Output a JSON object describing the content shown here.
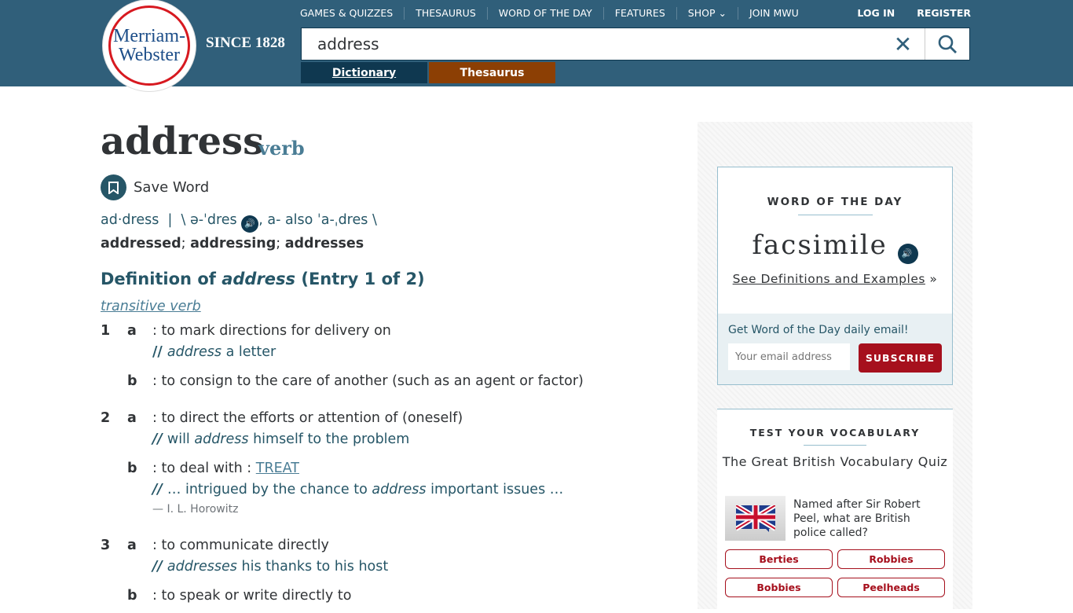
{
  "header": {
    "logo_text": "Merriam-Webster",
    "since": "SINCE 1828",
    "nav": [
      "GAMES & QUIZZES",
      "THESAURUS",
      "WORD OF THE DAY",
      "FEATURES",
      "SHOP",
      "JOIN MWU"
    ],
    "login": "LOG IN",
    "register": "REGISTER",
    "search_value": "address",
    "tabs": {
      "dictionary": "Dictionary",
      "thesaurus": "Thesaurus"
    },
    "colors": {
      "bar": "#305f7a",
      "dictionary_tab": "#0f3850",
      "thesaurus_tab": "#8c3f04"
    }
  },
  "entry": {
    "headword": "address",
    "pos": "verb",
    "save": "Save Word",
    "syllables": "ad·dress",
    "pron1": "\\ ə-ˈdres",
    "pron_also": ", a- also ˈa-ˌdres \\",
    "inflections": [
      "addressed",
      "addressing",
      "addresses"
    ],
    "def_heading_pre": "Definition of ",
    "def_heading_word": "address",
    "def_heading_post": " (Entry 1 of 2)",
    "function": "transitive verb",
    "senses": [
      {
        "num": "1",
        "letter": "a",
        "text": ": to mark directions for delivery on",
        "ex_pre": "",
        "ex_word": "address",
        "ex_post": " a letter"
      },
      {
        "letter": "b",
        "text": ": to consign to the care of another (such as an agent or factor)"
      },
      {
        "num": "2",
        "letter": "a",
        "text": ": to direct the efforts or attention of (oneself)",
        "ex_pre": "will ",
        "ex_word": "address",
        "ex_post": " himself to the problem"
      },
      {
        "letter": "b",
        "text": ": to deal with : ",
        "link": "TREAT",
        "ex_pre": "… intrigued by the chance to ",
        "ex_word": "address",
        "ex_post": " important issues …",
        "attr": "— I. L. Horowitz"
      },
      {
        "num": "3",
        "letter": "a",
        "text": ": to communicate directly",
        "ex_pre": "",
        "ex_word": "addresses",
        "ex_post": " his thanks to his host"
      },
      {
        "letter": "b",
        "text": ": to speak or write directly to"
      }
    ]
  },
  "sidebar": {
    "wotd": {
      "label": "WORD OF THE DAY",
      "word": "facsimile",
      "link": "See Definitions and Examples",
      "email_prompt": "Get Word of the Day daily email!",
      "email_placeholder": "Your email address",
      "subscribe": "SUBSCRIBE"
    },
    "vocab": {
      "label": "TEST YOUR VOCABULARY",
      "quiz": "The Great British Vocabulary Quiz",
      "question": "Named after Sir Robert Peel, what are British police called?",
      "answers": [
        "Berties",
        "Robbies",
        "Bobbies",
        "Peelheads"
      ]
    }
  }
}
